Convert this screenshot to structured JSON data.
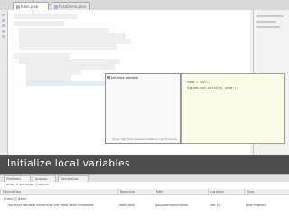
{
  "caption": "Initialize local variables",
  "editor_tabs": [
    {
      "label": "Main.java"
    },
    {
      "label": "FirstDemo.java"
    }
  ],
  "quickfix": {
    "item": "Initialize variable",
    "footer": "Press 'Tab' from proposal table or click for focus",
    "preview": [
      "name = null;",
      "System.out.println( name );"
    ]
  },
  "problems": {
    "tabs": [
      "Problems",
      "Javadoc",
      "Declaration"
    ],
    "summary": "1 error, 0 warnings, 0 others",
    "columns": [
      "Description",
      "Resource",
      "Path",
      "Location",
      "Type"
    ],
    "rows": [
      {
        "desc": "Errors (1 item)",
        "resource": "",
        "path": "",
        "location": "",
        "type": ""
      },
      {
        "desc": "The local variable name may not have been initialized",
        "resource": "Main.java",
        "path": "/JavaDemo/src/demo",
        "location": "line 10",
        "type": "Java Problem"
      }
    ]
  }
}
